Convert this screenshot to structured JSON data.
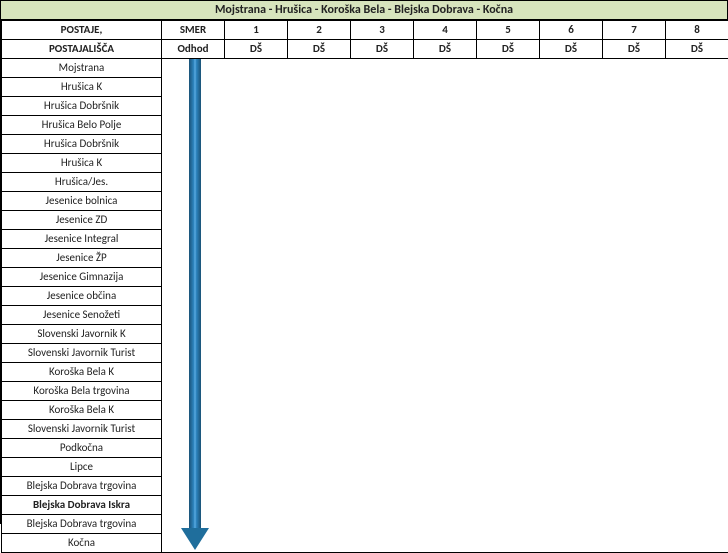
{
  "title": "Mojstrana - Hrušica - Koroška Bela - Blejska Dobrava - Kočna",
  "header": {
    "stops_label": "POSTAJE,",
    "stops_label2": "POSTAJALIŠČA",
    "dir_label": "SMER",
    "dir_label2": "Odhod",
    "cols": [
      "1",
      "2",
      "3",
      "4",
      "5",
      "6",
      "7",
      "8"
    ],
    "cols2": [
      "DŠ",
      "DŠ",
      "DŠ",
      "DŠ",
      "DŠ",
      "DŠ",
      "DŠ",
      "DŠ"
    ]
  },
  "stops": [
    {
      "name": "Mojstrana",
      "bold": false
    },
    {
      "name": "Hrušica K",
      "bold": false
    },
    {
      "name": "Hrušica Dobršnik",
      "bold": false
    },
    {
      "name": "Hrušica Belo Polje",
      "bold": false
    },
    {
      "name": "Hrušica Dobršnik",
      "bold": false
    },
    {
      "name": "Hrušica K",
      "bold": false
    },
    {
      "name": "Hrušica/Jes.",
      "bold": false
    },
    {
      "name": "Jesenice bolnica",
      "bold": false
    },
    {
      "name": "Jesenice ZD",
      "bold": false
    },
    {
      "name": "Jesenice Integral",
      "bold": false
    },
    {
      "name": "Jesenice ŽP",
      "bold": false
    },
    {
      "name": "Jesenice Gimnazija",
      "bold": false
    },
    {
      "name": "Jesenice občina",
      "bold": false
    },
    {
      "name": "Jesenice Senožeti",
      "bold": false
    },
    {
      "name": "Slovenski Javornik K",
      "bold": false
    },
    {
      "name": "Slovenski Javornik Turist",
      "bold": false
    },
    {
      "name": "Koroška Bela K",
      "bold": false
    },
    {
      "name": "Koroška Bela trgovina",
      "bold": false
    },
    {
      "name": "Koroška Bela K",
      "bold": false
    },
    {
      "name": "Slovenski Javornik Turist",
      "bold": false
    },
    {
      "name": "Podkočna",
      "bold": false
    },
    {
      "name": "Lipce",
      "bold": false
    },
    {
      "name": "Blejska Dobrava trgovina",
      "bold": false
    },
    {
      "name": "Blejska Dobrava Iskra",
      "bold": true
    },
    {
      "name": "Blejska Dobrava trgovina",
      "bold": false
    },
    {
      "name": "Kočna",
      "bold": false
    }
  ]
}
